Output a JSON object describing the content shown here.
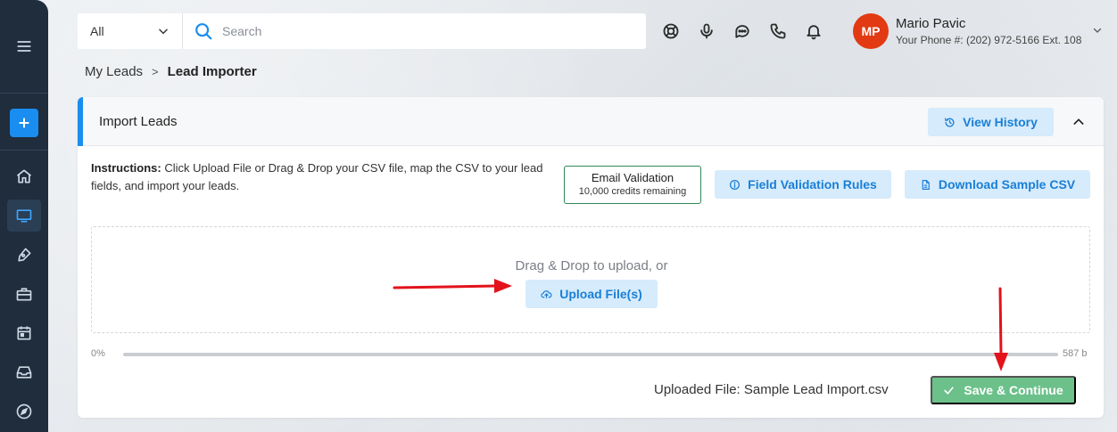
{
  "search": {
    "scope_value": "All",
    "placeholder": "Search"
  },
  "user": {
    "initials": "MP",
    "name": "Mario Pavic",
    "phone": "Your Phone #: (202) 972-5166 Ext. 108"
  },
  "breadcrumb": {
    "parent": "My Leads",
    "separator": ">",
    "current": "Lead Importer"
  },
  "card": {
    "title": "Import Leads",
    "view_history_label": "View History",
    "instructions_label": "Instructions:",
    "instructions_text": " Click Upload File or Drag & Drop your CSV file, map the CSV to your lead fields, and import your leads.",
    "email_validation": {
      "title": "Email Validation",
      "credits": "10,000 credits remaining"
    },
    "field_validation_label": "Field Validation Rules",
    "download_sample_label": "Download Sample CSV",
    "dropzone_text": "Drag & Drop to upload, or",
    "upload_button_label": "Upload File(s)",
    "progress": {
      "left_label": "0%",
      "right_label": "587 b",
      "value_percent": 0
    },
    "uploaded_file_text": "Uploaded File: Sample Lead Import.csv",
    "save_button_label": "Save & Continue"
  },
  "colors": {
    "sidebar_bg": "#1f2d3d",
    "accent_blue": "#1a8df0",
    "light_button_bg": "#d6ebfb",
    "avatar_bg": "#e23a13",
    "save_green": "#6cc08a",
    "annotation_arrow": "#e3121b"
  },
  "icons": {
    "sidebar": [
      "menu-icon",
      "plus-icon",
      "home-icon",
      "monitor-icon",
      "pen-icon",
      "briefcase-icon",
      "calendar-icon",
      "inbox-icon",
      "compass-icon"
    ],
    "header": [
      "support-icon",
      "microphone-icon",
      "chat-icon",
      "phone-icon",
      "bell-icon"
    ]
  }
}
